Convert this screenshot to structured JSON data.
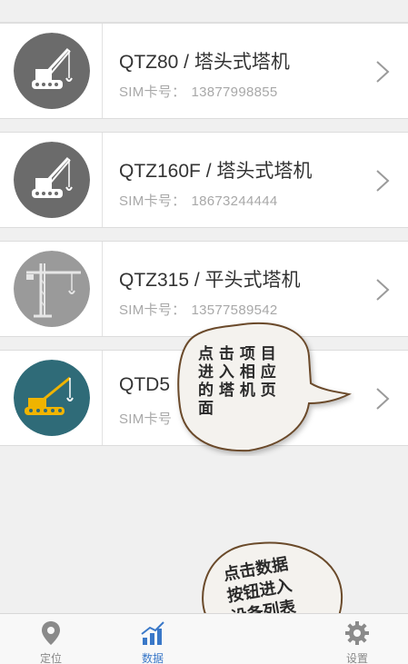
{
  "devices": [
    {
      "title": "QTZ80 / 塔头式塔机",
      "sim_label": "SIM卡号：",
      "sim": "13877998855",
      "icon": "crawler-crane-icon"
    },
    {
      "title": "QTZ160F / 塔头式塔机",
      "sim_label": "SIM卡号：",
      "sim": "18673244444",
      "icon": "crawler-crane-icon"
    },
    {
      "title": "QTZ315 / 平头式塔机",
      "sim_label": "SIM卡号：",
      "sim": "13577589542",
      "icon": "tower-crane-icon"
    },
    {
      "title": "QTD5",
      "sim_label": "SIM卡号",
      "sim": "",
      "icon": "yellow-crane-icon"
    }
  ],
  "bubbles": {
    "top": {
      "lines": [
        "点 击 项 目",
        "进 入 相 应",
        "的 塔 机 页",
        "面"
      ]
    },
    "bottom": {
      "lines": [
        "点击数据",
        "按钮进入",
        "设备列表"
      ]
    }
  },
  "tabs": [
    {
      "label": "定位",
      "icon": "location-pin-icon",
      "active": false
    },
    {
      "label": "数据",
      "icon": "data-chart-icon",
      "active": true
    },
    {
      "label": "",
      "icon": "",
      "active": false
    },
    {
      "label": "设置",
      "icon": "gear-icon",
      "active": false
    }
  ],
  "colors": {
    "accent": "#3a78c8",
    "avatar_dark": "#6b6b6b",
    "avatar_light": "#9a9a9a",
    "avatar_teal": "#2f6b78",
    "crane_yellow": "#f0b400"
  }
}
